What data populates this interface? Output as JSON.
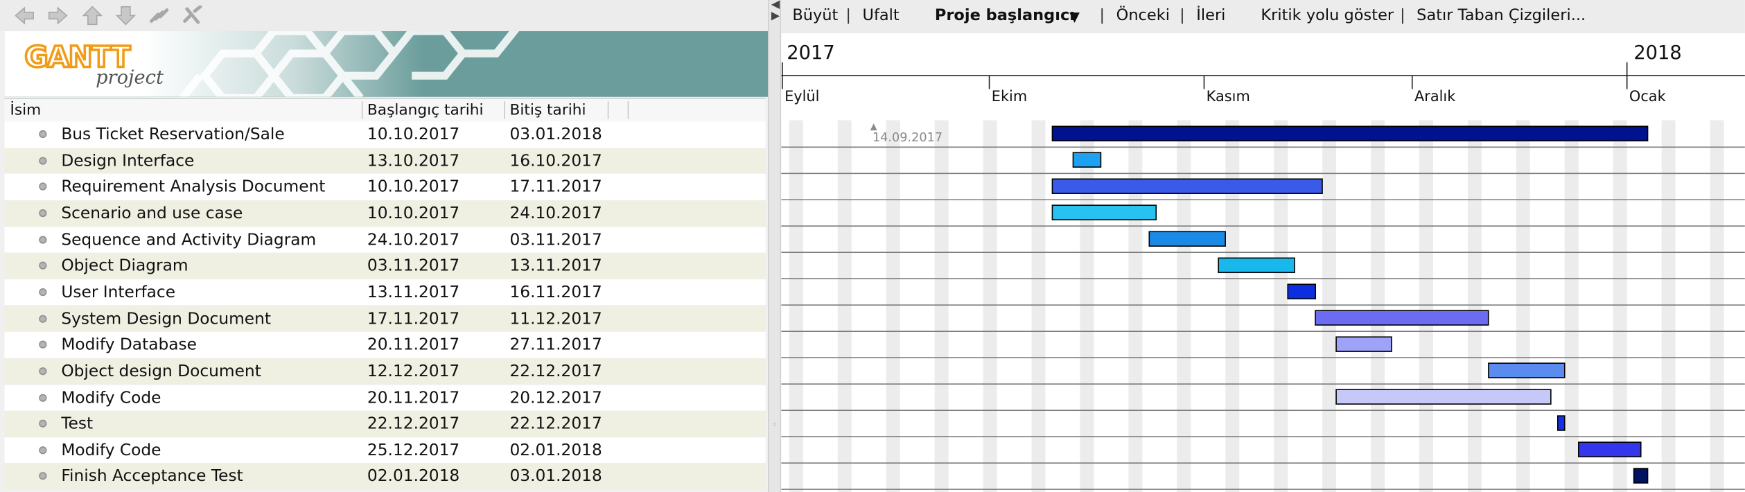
{
  "toolbar": {
    "icons": [
      "back-arrow-icon",
      "forward-arrow-icon",
      "up-arrow-icon",
      "down-arrow-icon",
      "link-icon",
      "unlink-icon"
    ]
  },
  "logo": {
    "brand": "GANTT",
    "sub": "project",
    "banner_color": "#6a9d9b"
  },
  "table": {
    "columns": {
      "name": "İsim",
      "start": "Başlangıç tarihi",
      "end": "Bitiş tarihi"
    },
    "rows": [
      {
        "name": "Bus Ticket Reservation/Sale",
        "start": "10.10.2017",
        "end": "03.01.2018"
      },
      {
        "name": "Design Interface",
        "start": "13.10.2017",
        "end": "16.10.2017"
      },
      {
        "name": "Requirement Analysis Document",
        "start": "10.10.2017",
        "end": "17.11.2017"
      },
      {
        "name": "Scenario and use case",
        "start": "10.10.2017",
        "end": "24.10.2017"
      },
      {
        "name": "Sequence and Activity Diagram",
        "start": "24.10.2017",
        "end": "03.11.2017"
      },
      {
        "name": "Object Diagram",
        "start": "03.11.2017",
        "end": "13.11.2017"
      },
      {
        "name": "User Interface",
        "start": "13.11.2017",
        "end": "16.11.2017"
      },
      {
        "name": "System Design Document",
        "start": "17.11.2017",
        "end": "11.12.2017"
      },
      {
        "name": "Modify Database",
        "start": "20.11.2017",
        "end": "27.11.2017"
      },
      {
        "name": "Object design Document",
        "start": "12.12.2017",
        "end": "22.12.2017"
      },
      {
        "name": "Modify Code",
        "start": "20.11.2017",
        "end": "20.12.2017"
      },
      {
        "name": "Test",
        "start": "22.12.2017",
        "end": "22.12.2017"
      },
      {
        "name": "Modify Code",
        "start": "25.12.2017",
        "end": "02.01.2018"
      },
      {
        "name": "Finish Acceptance Test",
        "start": "02.01.2018",
        "end": "03.01.2018"
      }
    ]
  },
  "chart_toolbar": {
    "zoom_in": "Büyüt",
    "zoom_out": "Ufalt",
    "project_start": "Proje başlangıcı",
    "previous": "Önceki",
    "next": "İleri",
    "critical_path": "Kritik yolu göster",
    "baselines": "Satır Taban Çizgileri..."
  },
  "timeline": {
    "years": [
      "2017",
      "2018"
    ],
    "months": [
      "Eylül",
      "Ekim",
      "Kasım",
      "Aralık",
      "Ocak"
    ],
    "today_marker": "14.09.2017"
  },
  "bar_colors": [
    "#00128f",
    "#1da1f0",
    "#3a5ae8",
    "#27c2f0",
    "#1b8ae6",
    "#19b8ec",
    "#0b2fe0",
    "#6b6cf2",
    "#9ea2f8",
    "#5a8cf0",
    "#c6c9f8",
    "#1431e8",
    "#3336ea",
    "#001363"
  ]
}
